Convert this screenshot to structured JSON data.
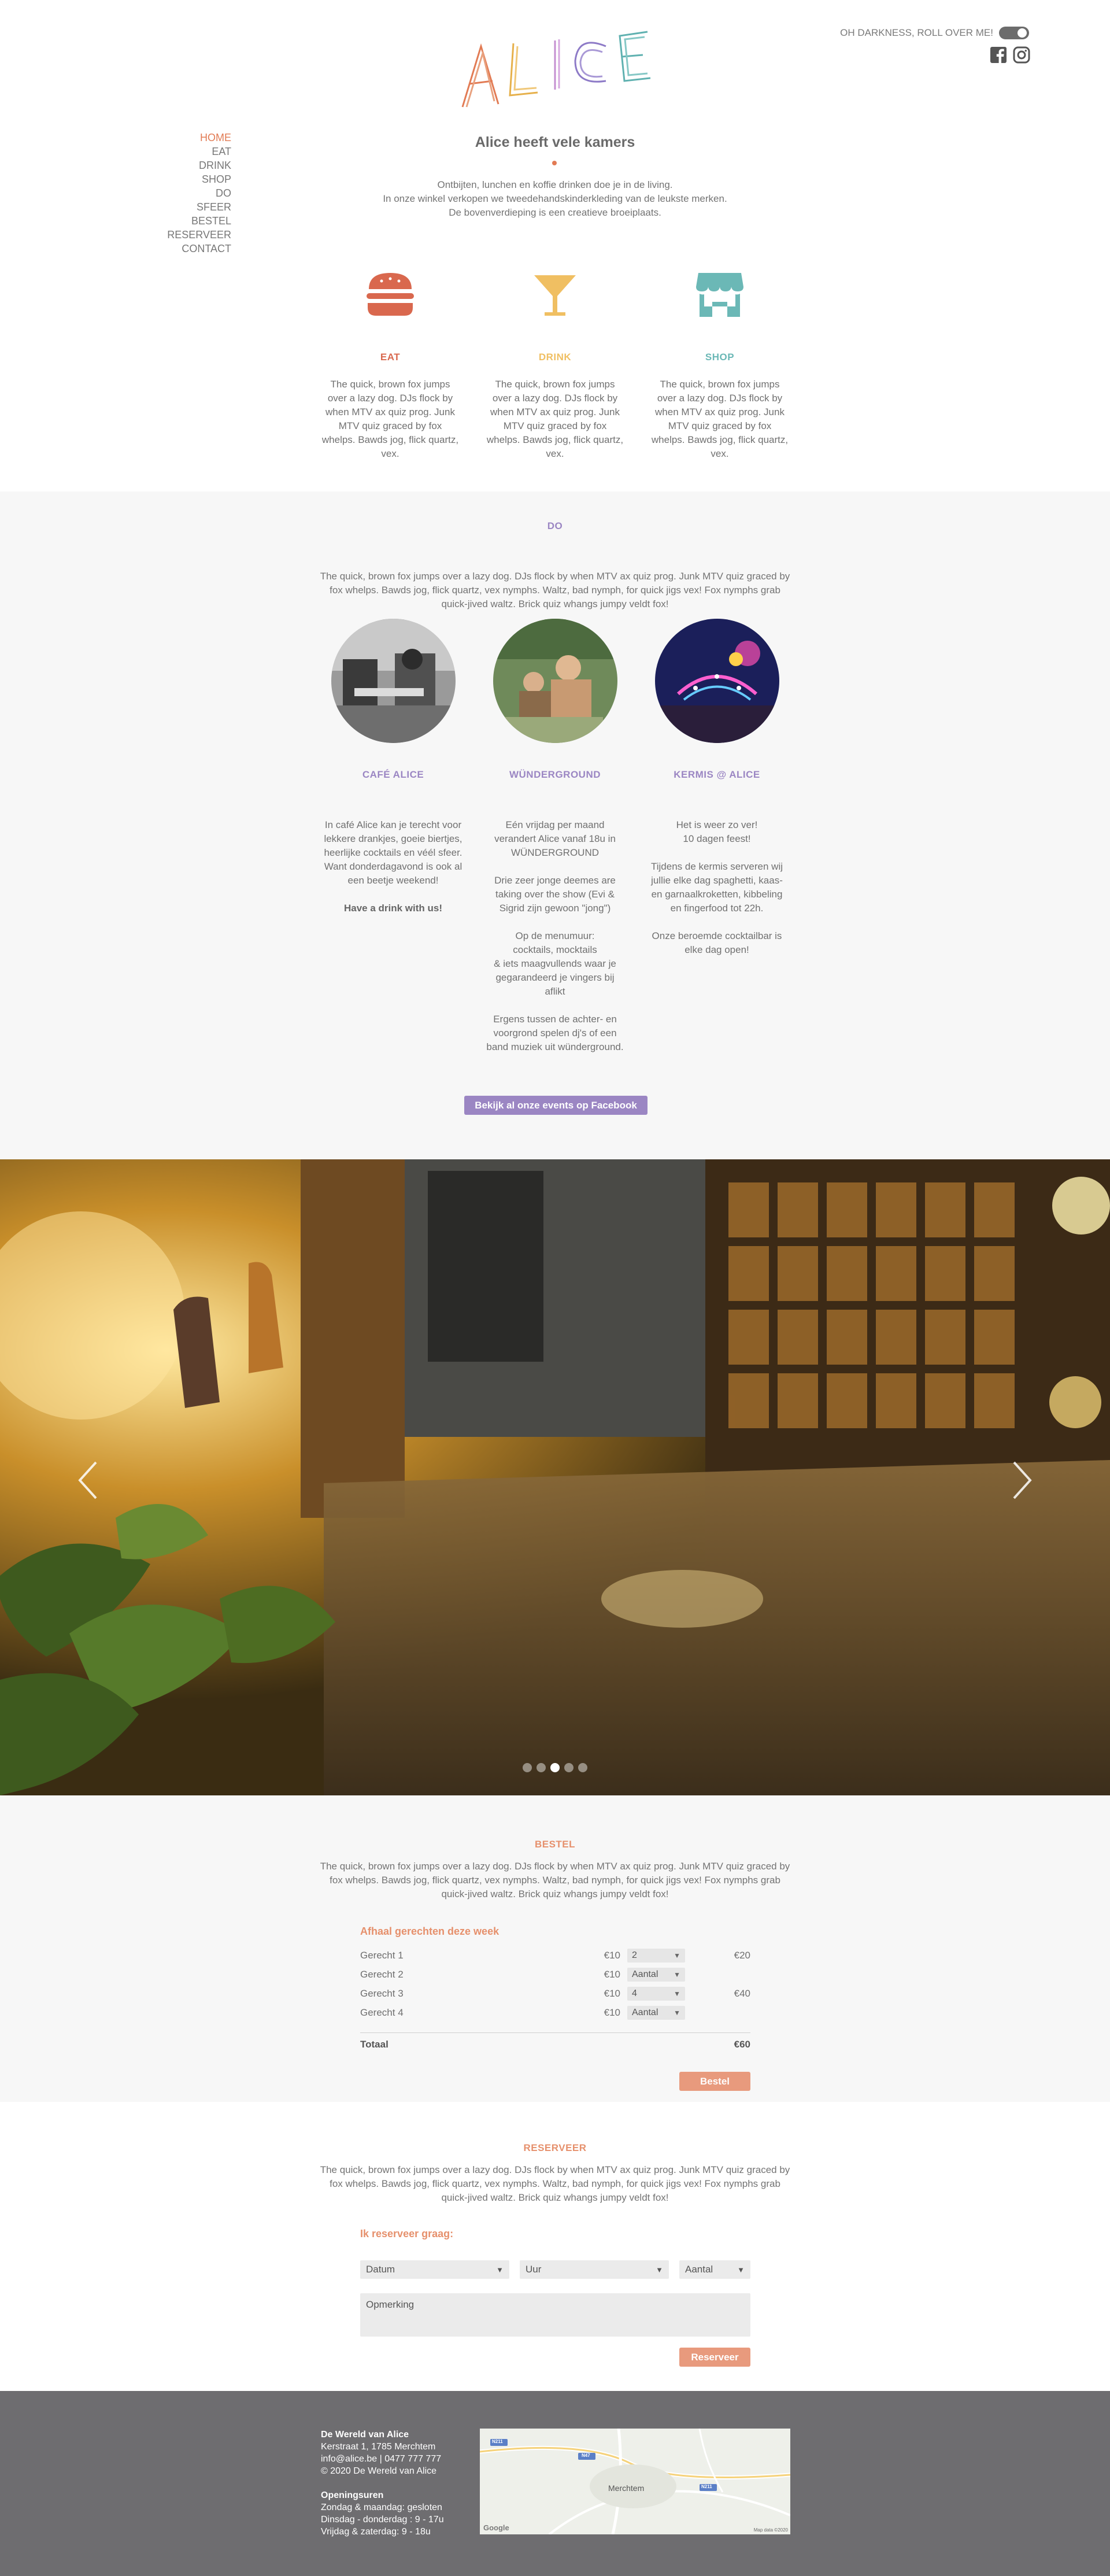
{
  "header": {
    "logo_text": "ALICE",
    "dark_mode_label": "OH DARKNESS, ROLL OVER ME!",
    "socials": [
      "facebook-icon",
      "instagram-icon"
    ]
  },
  "nav": {
    "items": [
      {
        "label": "HOME",
        "active": true
      },
      {
        "label": "EAT"
      },
      {
        "label": "DRINK"
      },
      {
        "label": "SHOP"
      },
      {
        "label": "DO"
      },
      {
        "label": "SFEER"
      },
      {
        "label": "BESTEL"
      },
      {
        "label": "RESERVEER"
      },
      {
        "label": "CONTACT"
      }
    ]
  },
  "intro": {
    "title": "Alice heeft vele kamers",
    "lines": [
      "Ontbijten, lunchen en koffie drinken doe je in de living.",
      "In onze winkel verkopen we tweedehandskinderkleding van de leukste merken.",
      "De bovenverdieping is een creatieve broeiplaats."
    ]
  },
  "features": [
    {
      "title": "EAT",
      "icon": "burger-icon",
      "color": "#d9684e",
      "text": "The quick, brown fox jumps over a lazy dog. DJs flock by when MTV ax quiz prog. Junk MTV quiz graced by fox whelps. Bawds jog, flick quartz, vex."
    },
    {
      "title": "DRINK",
      "icon": "cocktail-icon",
      "color": "#f0bf62",
      "text": "The quick, brown fox jumps over a lazy dog. DJs flock by when MTV ax quiz prog. Junk MTV quiz graced by fox whelps. Bawds jog, flick quartz, vex."
    },
    {
      "title": "SHOP",
      "icon": "shop-icon",
      "color": "#6bb8b6",
      "text": "The quick, brown fox jumps over a lazy dog. DJs flock by when MTV ax quiz prog. Junk MTV quiz graced by fox whelps. Bawds jog, flick quartz, vex."
    }
  ],
  "do": {
    "title": "DO",
    "title_color": "#9b86c3",
    "intro": "The quick, brown fox jumps over a lazy dog. DJs flock by when MTV ax quiz prog. Junk MTV quiz graced by fox whelps. Bawds jog, flick quartz, vex nymphs. Waltz, bad nymph, for quick jigs vex! Fox nymphs grab quick-jived waltz. Brick quiz whangs jumpy veldt fox!",
    "columns": [
      {
        "title": "CAFÉ ALICE",
        "paragraphs": [
          "In café Alice kan je terecht voor lekkere drankjes, goeie biertjes, heerlijke cocktails en véél sfeer.\nWant donderdagavond is ook al een beetje weekend!"
        ],
        "strong": "Have a drink with us!"
      },
      {
        "title": "WÜNDERGROUND",
        "paragraphs": [
          "Eén vrijdag per maand verandert Alice vanaf 18u in WÜNDERGROUND",
          "Drie zeer jonge deemes are taking over the show (Evi & Sigrid zijn gewoon \"jong\")",
          "Op de menumuur:\ncocktails, mocktails\n& iets maagvullends waar je gegarandeerd je vingers bij aflikt",
          "Ergens tussen de achter- en voorgrond spelen dj's of een band muziek uit wünderground."
        ],
        "strong": ""
      },
      {
        "title": "KERMIS @ ALICE",
        "paragraphs": [
          "Het is weer zo ver!\n10 dagen feest!",
          "Tijdens de kermis serveren wij jullie elke dag spaghetti, kaas- en garnaalkroketten, kibbeling en fingerfood tot 22h.",
          "Onze beroemde cocktailbar is elke dag open!"
        ],
        "strong": ""
      }
    ],
    "button": "Bekijk al onze events op Facebook"
  },
  "slider": {
    "slide_count": 5,
    "active_index": 2
  },
  "bestel": {
    "title": "BESTEL",
    "intro": "The quick, brown fox jumps over a lazy dog. DJs flock by when MTV ax quiz prog. Junk MTV quiz graced by fox whelps. Bawds jog, flick quartz, vex nymphs. Waltz, bad nymph, for quick jigs vex! Fox nymphs grab quick-jived waltz. Brick quiz whangs jumpy veldt fox!",
    "subtitle": "Afhaal gerechten deze week",
    "rows": [
      {
        "name": "Gerecht 1",
        "price": "€10",
        "qty": "2",
        "subtotal": "€20"
      },
      {
        "name": "Gerecht 2",
        "price": "€10",
        "qty": "Aantal",
        "subtotal": ""
      },
      {
        "name": "Gerecht 3",
        "price": "€10",
        "qty": "4",
        "subtotal": "€40"
      },
      {
        "name": "Gerecht 4",
        "price": "€10",
        "qty": "Aantal",
        "subtotal": ""
      }
    ],
    "total_label": "Totaal",
    "total_value": "€60",
    "button": "Bestel"
  },
  "reserveer": {
    "title": "RESERVEER",
    "intro": "The quick, brown fox jumps over a lazy dog. DJs flock by when MTV ax quiz prog. Junk MTV quiz graced by fox whelps. Bawds jog, flick quartz, vex nymphs. Waltz, bad nymph, for quick jigs vex! Fox nymphs grab quick-jived waltz. Brick quiz whangs jumpy veldt fox!",
    "subtitle": "Ik reserveer graag:",
    "datum": "Datum",
    "uur": "Uur",
    "aantal": "Aantal",
    "note_placeholder": "Opmerking",
    "button": "Reserveer"
  },
  "footer": {
    "name": "De Wereld van Alice",
    "address": "Kerstraat 1, 1785 Merchtem",
    "contact": "info@alice.be | 0477 777 777",
    "copyright": "© 2020 De Wereld van Alice",
    "hours_title": "Openingsuren",
    "hours": [
      "Zondag & maandag: gesloten",
      "Dinsdag - donderdag : 9 - 17u",
      "Vrijdag & zaterdag: 9 - 18u"
    ],
    "map_label": "Merchtem",
    "map_roads": [
      "N211",
      "N47",
      "N211"
    ],
    "map_brand": "Google",
    "map_credit": "Map data ©2020"
  }
}
